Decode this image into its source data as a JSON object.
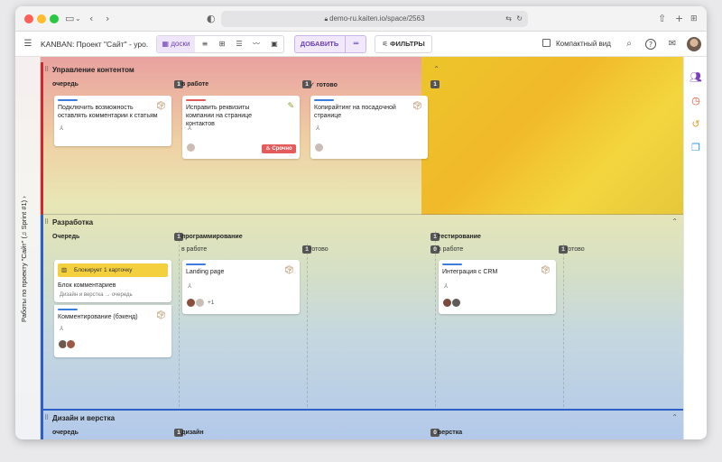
{
  "browser": {
    "url": "demo-ru.kaiten.io/space/2563",
    "colors": {
      "red": "#ff5f57",
      "yellow": "#febc2e",
      "green": "#28c840"
    }
  },
  "toolbar": {
    "board_title": "KANBAN: Проект \"Сайт\" - уро...",
    "boards_label": "доски",
    "add_label": "ДОБАВИТЬ",
    "filters_label": "ФИЛЬТРЫ",
    "compact_label": "Компактный вид"
  },
  "sidebar": {
    "vertical_label": "Работы по проекту \"Сайт\" (♫ Sprint #1) ›"
  },
  "lanes": [
    {
      "title": "Управление контентом",
      "color": "#d7262a",
      "columns": [
        {
          "title": "очередь",
          "count": "1"
        },
        {
          "title": "в работе",
          "count": "1"
        },
        {
          "title": "готово",
          "count": "1"
        }
      ],
      "cards": [
        {
          "title": "Подключить возможность оставлять комментарии к статьям",
          "stripe": "#3b7ddd"
        },
        {
          "title": "Исправить реквизиты компании на странице контактов",
          "stripe": "#e25b5b",
          "badge": "Срочно"
        },
        {
          "title": "Копирайтинг на посадочной странице",
          "stripe": "#3b7ddd"
        }
      ]
    },
    {
      "title": "Разработка",
      "color": "#2c5fc7",
      "columns": [
        {
          "title": "Очередь",
          "count": "1"
        },
        {
          "title": "программирование",
          "count": "1"
        },
        {
          "title": "тестирование",
          "count": "1"
        }
      ],
      "subcolumns": [
        {
          "title": "в работе",
          "count": "1"
        },
        {
          "title": "готово",
          "count": "0"
        },
        {
          "title": "в работе",
          "count": "1"
        },
        {
          "title": "готово",
          "count": "0"
        }
      ],
      "cards": [
        {
          "banner": "Блокирует 1 карточку",
          "title": "Блок комментариев",
          "sub": "Дизайн и верстка → очередь"
        },
        {
          "title": "Комментирование (бэкенд)",
          "stripe": "#3b7ddd"
        },
        {
          "title": "Landing page",
          "stripe": "#3b7ddd",
          "extra": "+1"
        },
        {
          "title": "Интеграция с CRM",
          "stripe": "#3b7ddd"
        }
      ]
    },
    {
      "title": "Дизайн и верстка",
      "color": "#2c5fc7",
      "columns": [
        {
          "title": "очередь",
          "count": "1"
        },
        {
          "title": "дизайн",
          "count": "0"
        },
        {
          "title": "верстка",
          "count": "0"
        }
      ]
    }
  ]
}
